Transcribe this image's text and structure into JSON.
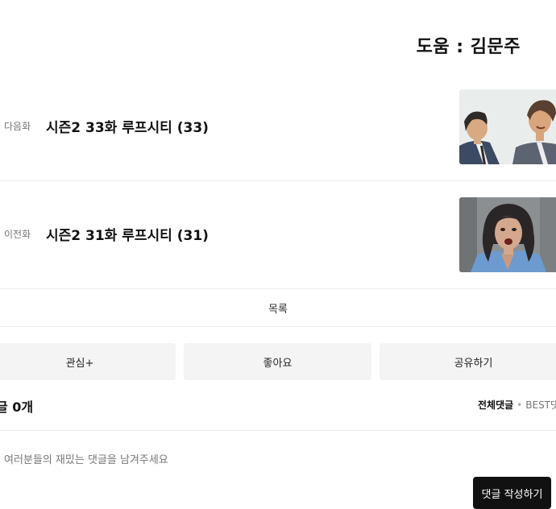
{
  "helper_credit": "도움 : 김문주",
  "next_episode": {
    "direction": "다음화",
    "title": "시즌2 33화 루프시티 (33)"
  },
  "prev_episode": {
    "direction": "이전화",
    "title": "시즌2 31화 루프시티 (31)"
  },
  "list_label": "목록",
  "actions": {
    "favorite": "관심+",
    "like": "좋아요",
    "share": "공유하기"
  },
  "comments": {
    "count_label": "글 0개",
    "sort_all": "전체댓글",
    "sort_separator": "•",
    "sort_best": "BEST댓",
    "input_placeholder": "여러분들의 재밌는 댓글을 남겨주세요",
    "write_button": "댓글 작성하기"
  }
}
